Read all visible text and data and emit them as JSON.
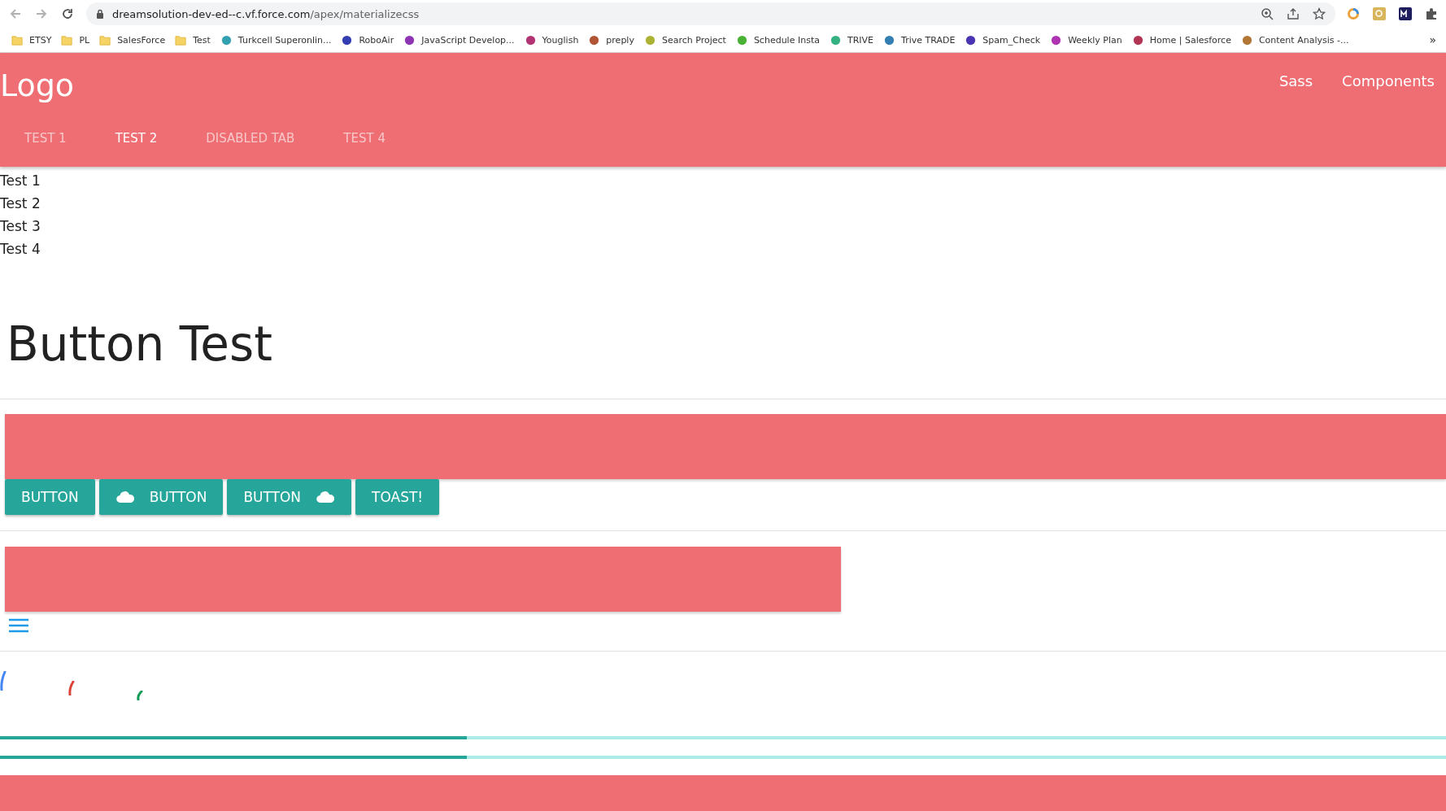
{
  "browser": {
    "url_host": "dreamsolution-dev-ed--c.vf.force.com",
    "url_path": "/apex/materializecss",
    "bookmarks": [
      {
        "label": "ETSY",
        "kind": "folder"
      },
      {
        "label": "PL",
        "kind": "folder"
      },
      {
        "label": "SalesForce",
        "kind": "folder"
      },
      {
        "label": "Test",
        "kind": "folder"
      },
      {
        "label": "Turkcell Superonlin...",
        "kind": "site"
      },
      {
        "label": "RoboAir",
        "kind": "site"
      },
      {
        "label": "JavaScript Develop...",
        "kind": "site"
      },
      {
        "label": "Youglish",
        "kind": "site"
      },
      {
        "label": "preply",
        "kind": "site"
      },
      {
        "label": "Search Project",
        "kind": "site"
      },
      {
        "label": "Schedule Insta",
        "kind": "site"
      },
      {
        "label": "TRIVE",
        "kind": "site"
      },
      {
        "label": "Trive TRADE",
        "kind": "site"
      },
      {
        "label": "Spam_Check",
        "kind": "site"
      },
      {
        "label": "Weekly Plan",
        "kind": "site"
      },
      {
        "label": "Home | Salesforce",
        "kind": "site"
      },
      {
        "label": "Content Analysis -...",
        "kind": "site"
      }
    ],
    "more": "»"
  },
  "navbar": {
    "logo": "Logo",
    "links": [
      "Sass",
      "Components"
    ],
    "tabs": [
      {
        "label": "TEST 1",
        "selected": false
      },
      {
        "label": "TEST 2",
        "selected": true
      },
      {
        "label": "DISABLED TAB",
        "selected": false
      },
      {
        "label": "TEST 4",
        "selected": false
      }
    ]
  },
  "list": [
    "Test 1",
    "Test 2",
    "Test 3",
    "Test 4"
  ],
  "heading": "Button Test",
  "buttons": [
    {
      "label": "BUTTON",
      "kind": "plain"
    },
    {
      "label": "BUTTON",
      "kind": "leading"
    },
    {
      "label": "BUTTON",
      "kind": "trailing"
    },
    {
      "label": "TOAST!",
      "kind": "plain"
    }
  ],
  "spinners": [
    {
      "color": "#4285f4"
    },
    {
      "color": "#db4437"
    },
    {
      "color": "#0f9d58"
    }
  ],
  "progress": [
    {
      "level": 0.323
    },
    {
      "level": 0.323
    }
  ]
}
